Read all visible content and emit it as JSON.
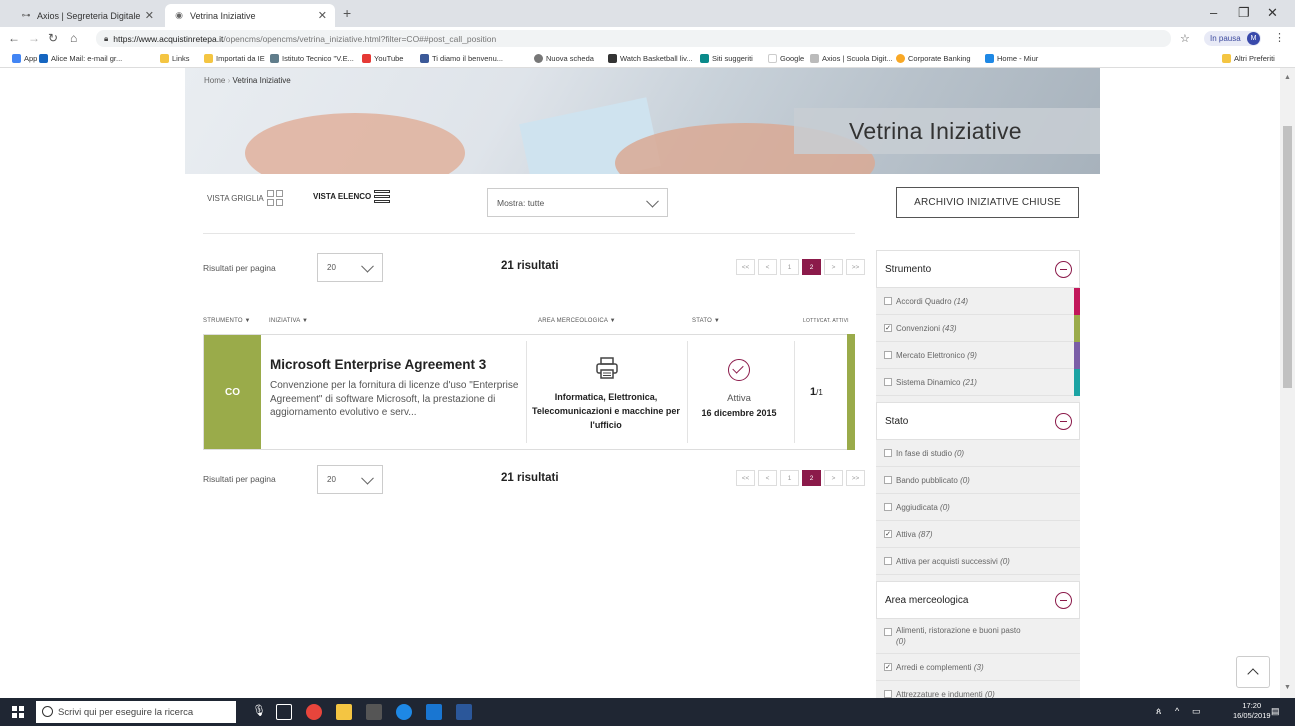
{
  "browser": {
    "tabs": [
      {
        "label": "Axios | Segreteria Digitale"
      },
      {
        "label": "Vetrina Iniziative"
      }
    ],
    "url_host": "https://www.acquistinretepa.it",
    "url_path": "/opencms/opencms/vetrina_iniziative.html?filter=CO##post_call_position",
    "profile_status": "In pausa",
    "profile_initial": "M",
    "bookmarks": [
      "App",
      "Alice Mail: e-mail gr...",
      "Links",
      "Importati da IE",
      "Istituto Tecnico \"V.E...",
      "YouTube",
      "Ti diamo il benvenu...",
      "Nuova scheda",
      "Watch Basketball liv...",
      "Siti suggeriti",
      "Google",
      "Axios | Scuola Digit...",
      "Corporate Banking",
      "Home - Miur"
    ],
    "other_bookmarks": "Altri Preferiti"
  },
  "page": {
    "breadcrumb": {
      "home": "Home",
      "current": "Vetrina Iniziative"
    },
    "hero_title": "Vetrina Iniziative",
    "view_grid_label": "VISTA GRIGLIA",
    "view_list_label": "VISTA ELENCO",
    "filter_select": "Mostra: tutte",
    "archive_button": "ARCHIVIO INIZIATIVE CHIUSE",
    "per_page_label": "Risultati per pagina",
    "per_page_value": "20",
    "results_count": "21 risultati",
    "pager": [
      "<<",
      "<",
      "1",
      "2",
      ">",
      ">>"
    ],
    "pager_active": "2",
    "columns": {
      "strumento": "STRUMENTO ▼",
      "iniziativa": "INIZIATIVA ▼",
      "area": "AREA MERCEOLOGICA ▼",
      "stato": "STATO ▼",
      "lotti": "LOTTI/CAT. ATTIVI"
    },
    "row": {
      "tag": "CO",
      "title": "Microsoft Enterprise Agreement 3",
      "description": "Convenzione per la fornitura di licenze d'uso \"Enterprise Agreement\" di software Microsoft, la prestazione di aggiornamento evolutivo e serv...",
      "area": "Informatica, Elettronica, Telecomunicazioni e macchine per l'ufficio",
      "stato": "Attiva",
      "date": "16 dicembre 2015",
      "lotti_main": "1",
      "lotti_total": "/1",
      "accent": "#9aab4a"
    }
  },
  "sidebar": {
    "strumento": {
      "title": "Strumento",
      "items": [
        {
          "label": "Accordi Quadro",
          "count": "(14)",
          "checked": false,
          "color": "#c2185b"
        },
        {
          "label": "Convenzioni",
          "count": "(43)",
          "checked": true,
          "color": "#9aab4a"
        },
        {
          "label": "Mercato Elettronico",
          "count": "(9)",
          "checked": false,
          "color": "#7b5ea7"
        },
        {
          "label": "Sistema Dinamico",
          "count": "(21)",
          "checked": false,
          "color": "#1ba3a3"
        }
      ]
    },
    "stato": {
      "title": "Stato",
      "items": [
        {
          "label": "In fase di studio",
          "count": "(0)",
          "checked": false
        },
        {
          "label": "Bando pubblicato",
          "count": "(0)",
          "checked": false
        },
        {
          "label": "Aggiudicata",
          "count": "(0)",
          "checked": false
        },
        {
          "label": "Attiva",
          "count": "(87)",
          "checked": true
        },
        {
          "label": "Attiva per acquisti successivi",
          "count": "(0)",
          "checked": false
        }
      ]
    },
    "area": {
      "title": "Area merceologica",
      "items": [
        {
          "label": "Alimenti, ristorazione e buoni pasto",
          "count": "(0)",
          "checked": false
        },
        {
          "label": "Arredi e complementi",
          "count": "(3)",
          "checked": true
        },
        {
          "label": "Attrezzature e indumenti",
          "count": "(0)",
          "checked": false
        }
      ]
    }
  },
  "taskbar": {
    "search_placeholder": "Scrivi qui per eseguire la ricerca",
    "time": "17:20",
    "date": "16/05/2019"
  },
  "colors": {
    "brand": "#8b1a4a",
    "co_green": "#9aab4a"
  }
}
